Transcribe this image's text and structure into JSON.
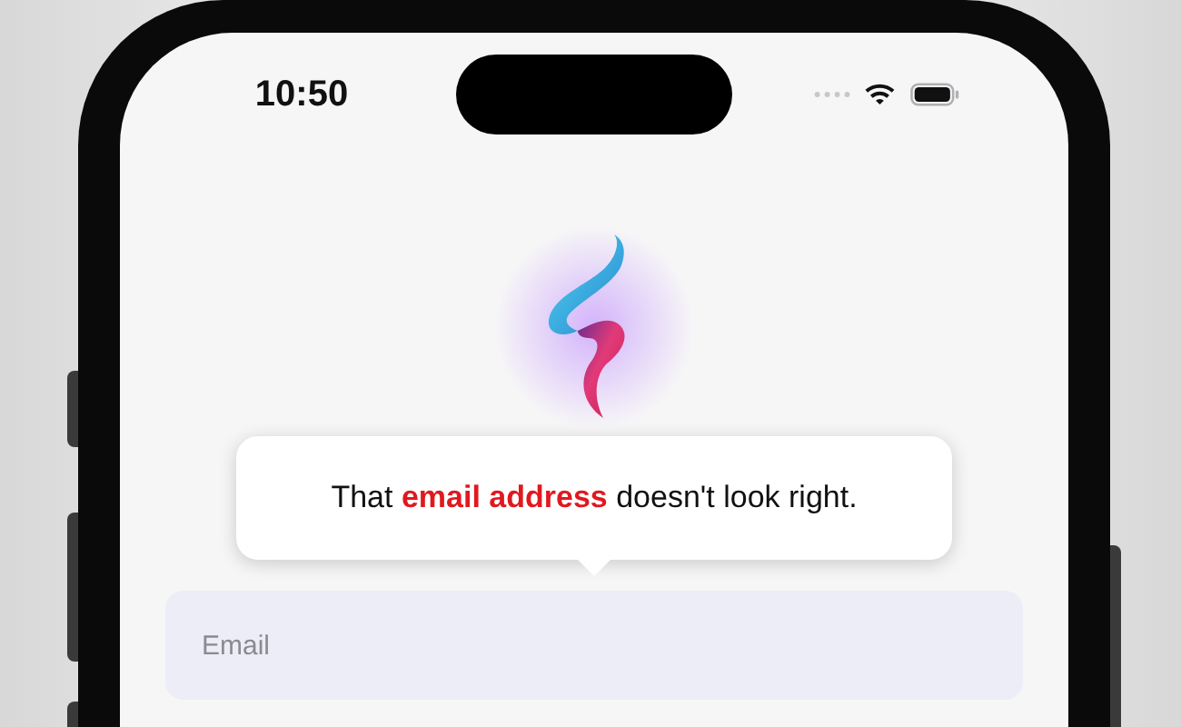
{
  "status_bar": {
    "time": "10:50"
  },
  "tooltip": {
    "message": "That **email address** doesn't look right."
  },
  "email_field": {
    "placeholder": "Email"
  }
}
